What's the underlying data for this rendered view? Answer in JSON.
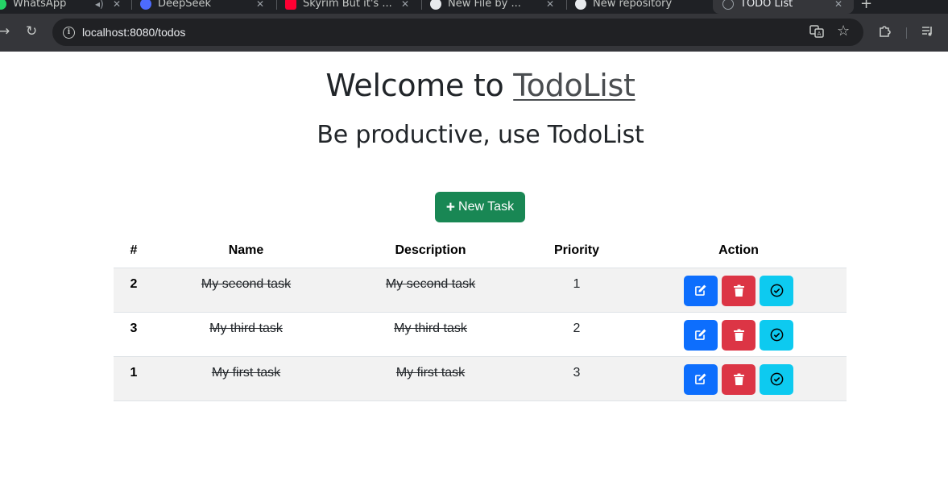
{
  "browser": {
    "tabs": [
      {
        "label": "WhatsApp",
        "active": false
      },
      {
        "label": "DeepSeek",
        "active": false
      },
      {
        "label": "Skyrim But it's ...",
        "active": false
      },
      {
        "label": "New File by ...",
        "active": false
      },
      {
        "label": "New repository",
        "active": false
      },
      {
        "label": "TODO List",
        "active": true
      }
    ],
    "url": "localhost:8080/todos"
  },
  "page": {
    "title_prefix": "Welcome to",
    "title_link": "TodoList",
    "subtitle": "Be productive, use TodoList",
    "new_task_label": "New Task"
  },
  "table": {
    "headers": [
      "#",
      "Name",
      "Description",
      "Priority",
      "Action"
    ],
    "rows": [
      {
        "id": "2",
        "name": "My second task",
        "description": "My second task",
        "priority": "1",
        "completed": true
      },
      {
        "id": "3",
        "name": "My third task",
        "description": "My third task",
        "priority": "2",
        "completed": true
      },
      {
        "id": "1",
        "name": "My first task",
        "description": "My first task",
        "priority": "3",
        "completed": true
      }
    ]
  },
  "colors": {
    "success": "#198754",
    "primary": "#0d6efd",
    "danger": "#dc3545",
    "info": "#0dcaf0"
  }
}
